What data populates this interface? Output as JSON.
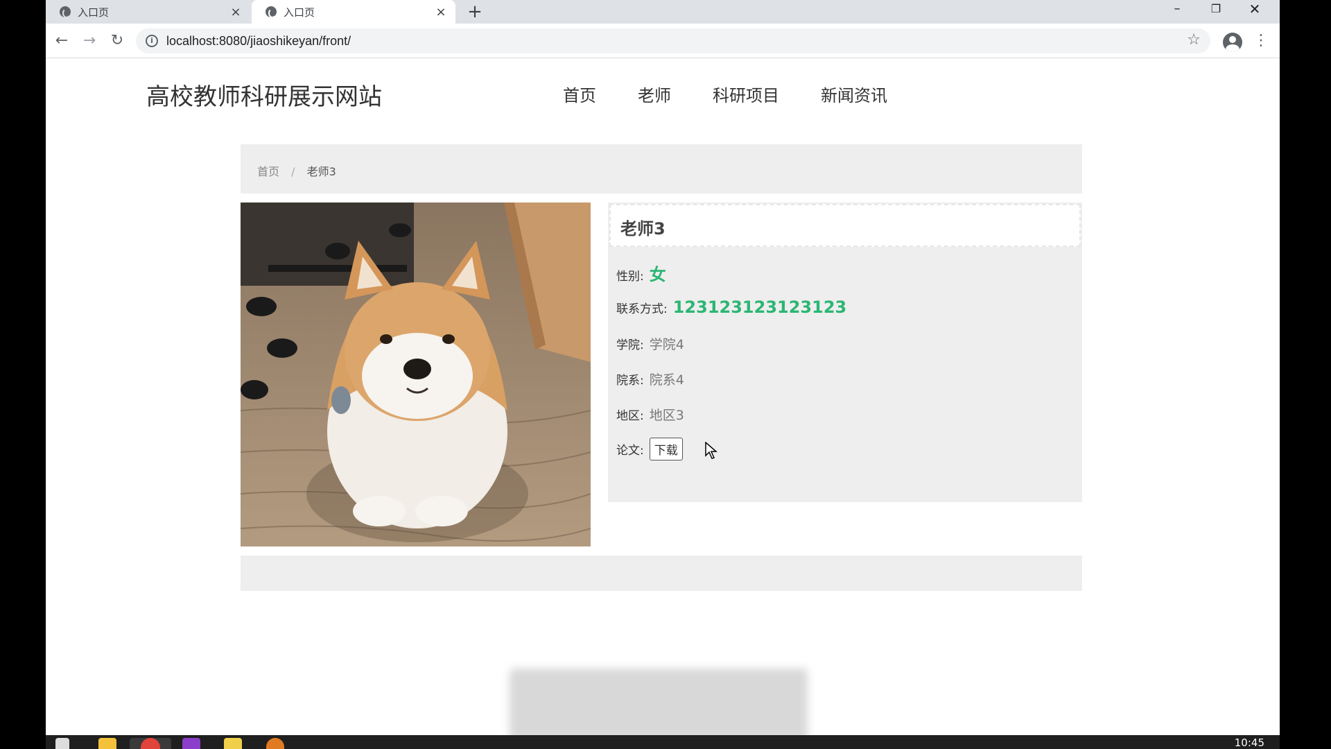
{
  "browser": {
    "tabs": [
      {
        "title": "入口页",
        "close": "×"
      },
      {
        "title": "入口页",
        "close": "×"
      }
    ],
    "new_tab": "+",
    "window_controls": {
      "minimize": "–",
      "maximize": "❐",
      "close": "✕"
    },
    "nav": {
      "back": "←",
      "forward": "→",
      "reload": "↻"
    },
    "url": "localhost:8080/jiaoshikeyan/front/",
    "bookmark_icon": "☆",
    "menu_icon": "⋮"
  },
  "site": {
    "title": "高校教师科研展示网站",
    "nav": [
      "首页",
      "老师",
      "科研项目",
      "新闻资讯"
    ]
  },
  "breadcrumb": {
    "home": "首页",
    "separator": "/",
    "current": "老师3"
  },
  "teacher": {
    "name": "老师3",
    "gender_label": "性别:",
    "gender": "女",
    "contact_label": "联系方式:",
    "contact": "123123123123123",
    "college_label": "学院:",
    "college": "学院4",
    "department_label": "院系:",
    "department": "院系4",
    "region_label": "地区:",
    "region": "地区3",
    "paper_label": "论文:",
    "paper_button": "下载"
  },
  "colors": {
    "accent_green": "#2bb673",
    "panel_bg": "#eeeeee"
  },
  "taskbar": {
    "clock": "10:45"
  }
}
